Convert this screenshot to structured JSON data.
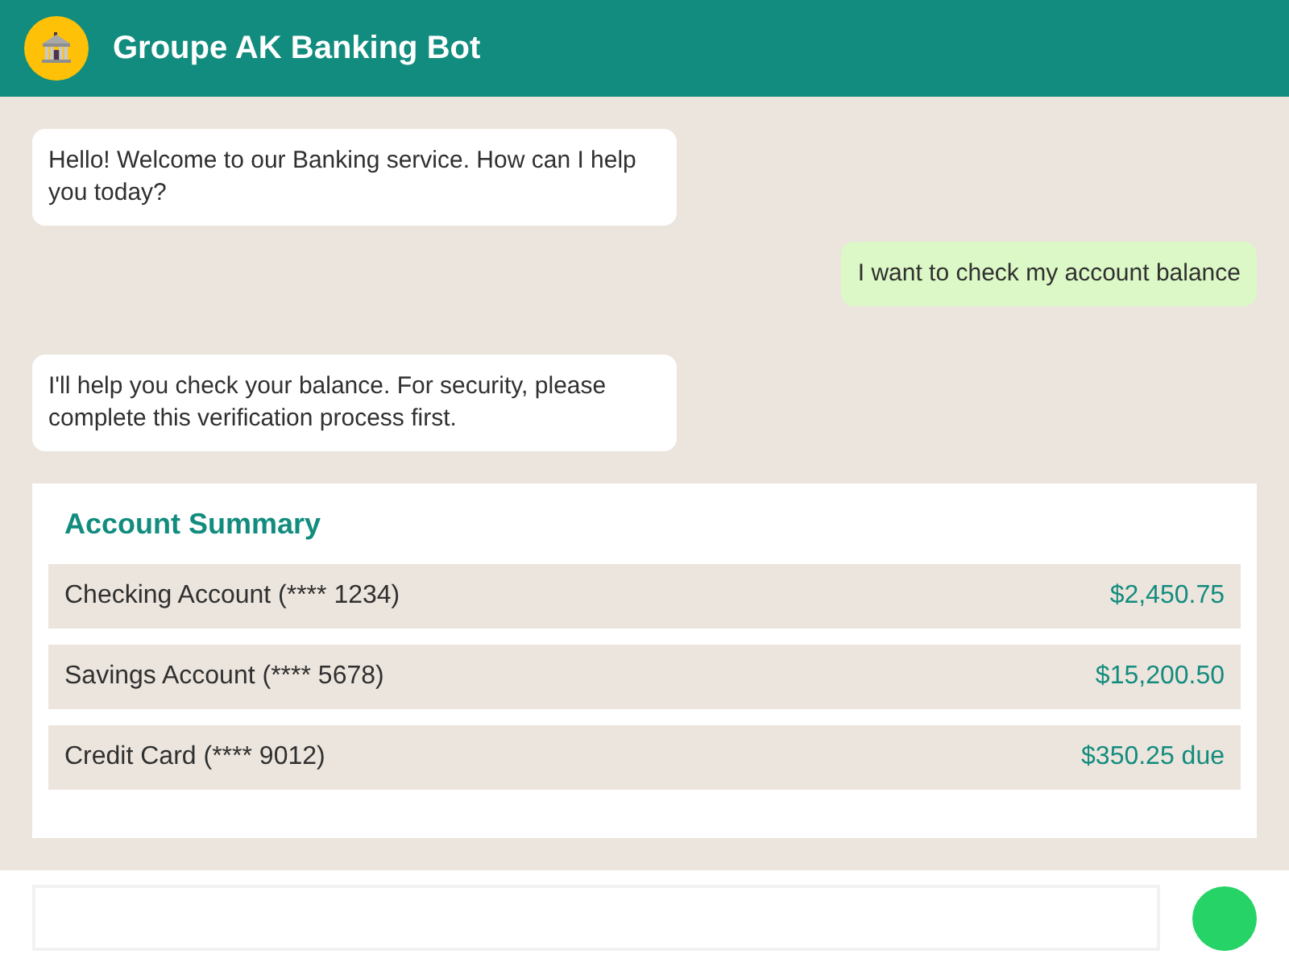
{
  "header": {
    "title": "Groupe AK Banking Bot"
  },
  "messages": [
    {
      "kind": "bot",
      "text": "Hello! Welcome to our Banking service. How can I help you today?"
    },
    {
      "kind": "user",
      "text": "I want to check my account balance"
    },
    {
      "kind": "bot",
      "text": "I'll help you check your balance. For security, please complete this verification process first."
    }
  ],
  "account_summary": {
    "title": "Account Summary",
    "accounts": [
      {
        "name": "Checking Account (**** 1234)",
        "amount": "$2,450.75"
      },
      {
        "name": "Savings Account (**** 5678)",
        "amount": "$15,200.50"
      },
      {
        "name": "Credit Card (**** 9012)",
        "amount": "$350.25 due"
      }
    ]
  }
}
